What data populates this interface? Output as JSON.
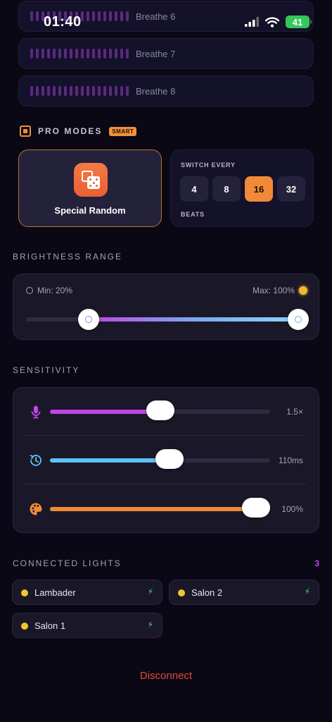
{
  "status": {
    "time": "01:40",
    "battery": "41"
  },
  "breathe_rows": [
    "Breathe 6",
    "Breathe 7",
    "Breathe 8"
  ],
  "pro_modes": {
    "title": "PRO MODES",
    "badge": "SMART",
    "mode_label": "Special Random",
    "switch_title": "SWITCH EVERY",
    "options": [
      "4",
      "8",
      "16",
      "32"
    ],
    "selected_option": "16",
    "unit_label": "BEATS"
  },
  "brightness": {
    "title": "BRIGHTNESS RANGE",
    "min_label": "Min: 20%",
    "max_label": "Max: 100%",
    "min_value": 20,
    "max_value": 100
  },
  "sensitivity": {
    "title": "SENSITIVITY",
    "rows": [
      {
        "icon": "microphone-icon",
        "value": "1.5×",
        "level": 0.5,
        "color": "#c244e8"
      },
      {
        "icon": "clock-refresh-icon",
        "value": "110ms",
        "level": 0.55,
        "color": "#5ec2f5"
      },
      {
        "icon": "palette-icon",
        "value": "100%",
        "level": 1.0,
        "color": "#f08a38"
      }
    ]
  },
  "lights": {
    "title": "CONNECTED LIGHTS",
    "count": "3",
    "items": [
      "Lambader",
      "Salon 2",
      "Salon 1"
    ]
  },
  "disconnect_label": "Disconnect"
}
